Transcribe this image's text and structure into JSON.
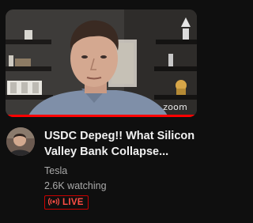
{
  "video": {
    "title": "USDC Depeg!! What Silicon Valley Bank Collapse...",
    "channel": "Tesla",
    "viewers": "2.6K watching",
    "live_label": "LIVE",
    "watermark": "zoom"
  },
  "icons": {
    "live": "live-broadcast-icon",
    "avatar": "channel-avatar"
  },
  "colors": {
    "background": "#0f0f0f",
    "live_red": "#ff0000",
    "live_text": "#ff4e45",
    "title": "#f1f1f1",
    "meta": "#aaaaaa"
  }
}
